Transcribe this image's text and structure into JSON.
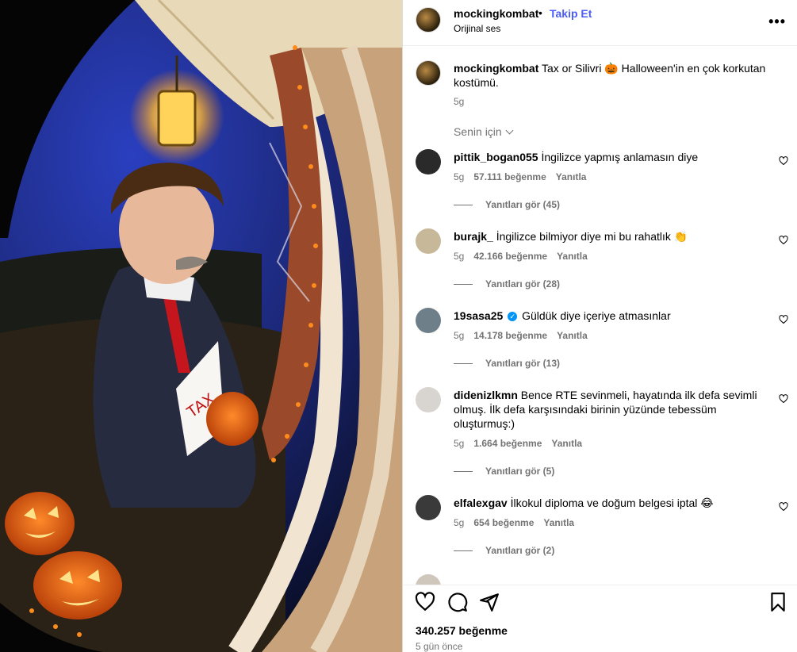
{
  "post": {
    "username": "mockingkombat",
    "follow_label": "Takip Et",
    "audio": "Orijinal ses",
    "caption_user": "mockingkombat",
    "caption_text": "Tax or Silivri 🎃 Halloween'in en çok korkutan kostümü.",
    "caption_time": "5g",
    "sign_text": "TAX"
  },
  "filter": {
    "label": "Senin için"
  },
  "comments": [
    {
      "user": "pittik_bogan055",
      "text": "İngilizce yapmış anlamasın diye",
      "time": "5g",
      "likes": "57.111 beğenme",
      "reply": "Yanıtla",
      "replies": "Yanıtları gör (45)"
    },
    {
      "user": "burajk_",
      "text": "İngilizce bilmiyor diye mi bu rahatlık 👏",
      "time": "5g",
      "likes": "42.166 beğenme",
      "reply": "Yanıtla",
      "replies": "Yanıtları gör (28)"
    },
    {
      "user": "19sasa25",
      "verified": true,
      "text": "Güldük diye içeriye atmasınlar",
      "time": "5g",
      "likes": "14.178 beğenme",
      "reply": "Yanıtla",
      "replies": "Yanıtları gör (13)"
    },
    {
      "user": "didenizlkmn",
      "text": "Bence RTE sevinmeli, hayatında ilk defa sevimli olmuş. İlk defa karşısındaki birinin yüzünde tebessüm oluşturmuş:)",
      "time": "5g",
      "likes": "1.664 beğenme",
      "reply": "Yanıtla",
      "replies": "Yanıtları gör (5)"
    },
    {
      "user": "elfalexgav",
      "text": "İlkokul diploma ve doğum belgesi iptal 😂",
      "time": "5g",
      "likes": "654 beğenme",
      "reply": "Yanıtla",
      "replies": "Yanıtları gör (2)"
    }
  ],
  "footer": {
    "likes_total": "340.257 beğenme",
    "ago": "5 gün önce"
  },
  "icons": [
    "more-icon",
    "heart-icon",
    "comment-icon",
    "share-icon",
    "bookmark-icon"
  ],
  "colors": {
    "follow": "#4a5df9",
    "muted": "#737373",
    "verified": "#0095f6"
  }
}
